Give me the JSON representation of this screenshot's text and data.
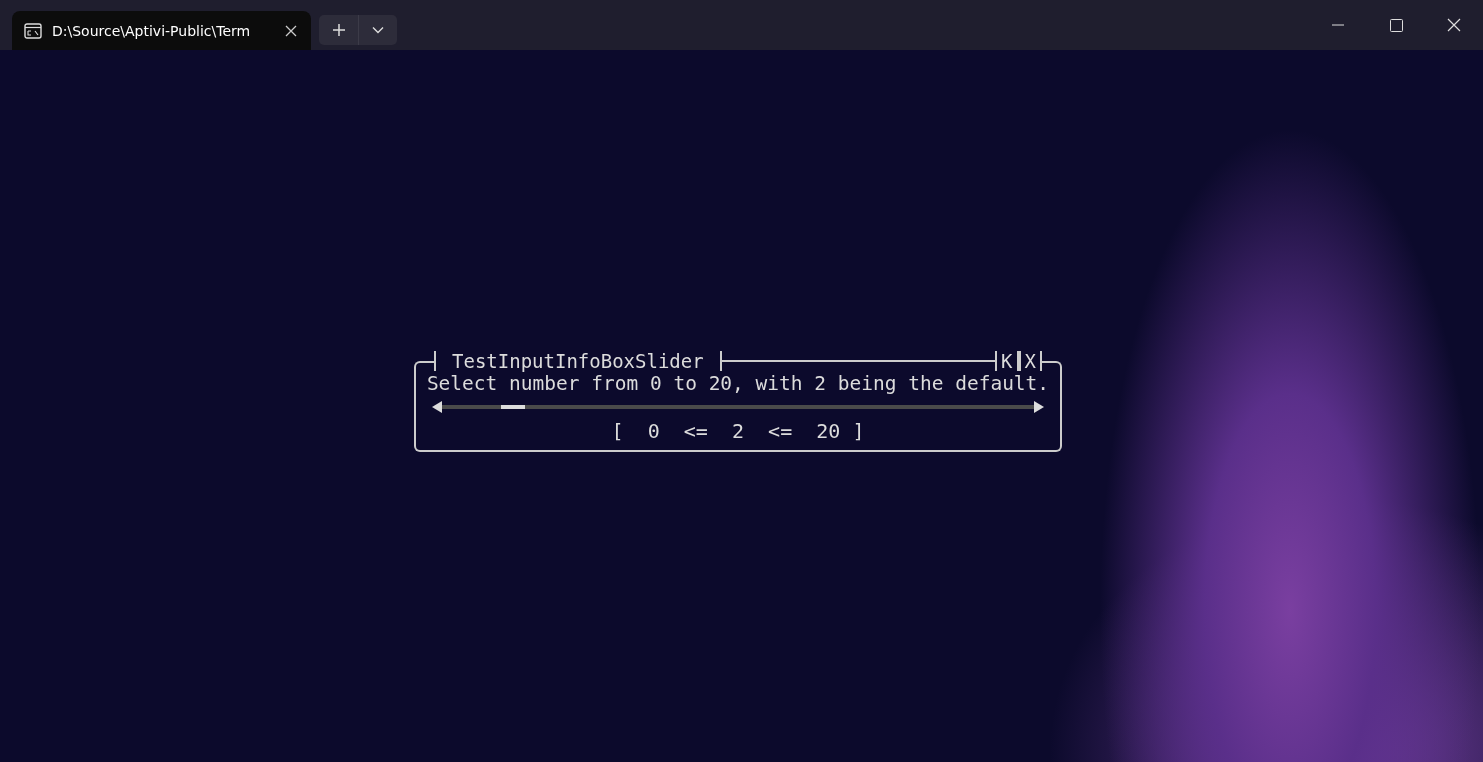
{
  "tab": {
    "title": "D:\\Source\\Aptivi-Public\\Term",
    "selected": true
  },
  "dialog": {
    "title": "TestInputInfoBoxSlider",
    "buttons": [
      "K",
      "X"
    ],
    "message": "Select number from 0 to 20, with 2 being the default.",
    "slider": {
      "level": 0.1
    },
    "reading": "[  0  <=  2  <=  20 ]"
  }
}
